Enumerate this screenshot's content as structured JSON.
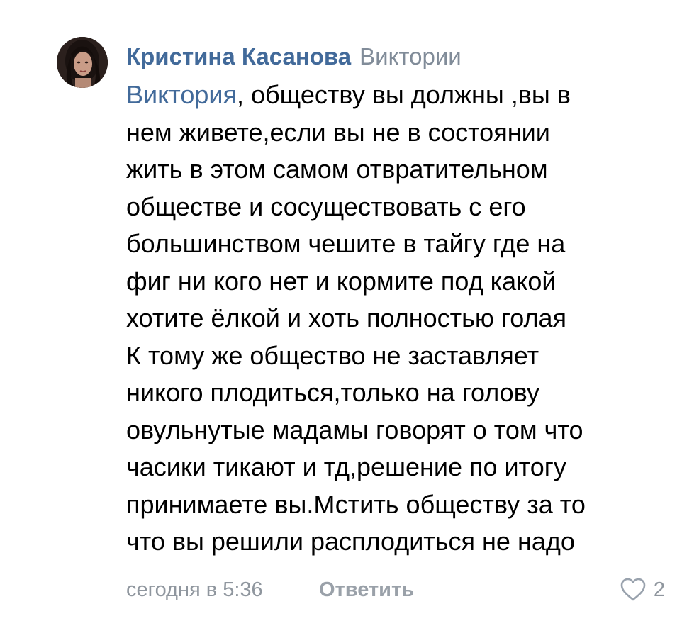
{
  "comment": {
    "author": "Кристина Касанова",
    "reply_to": "Виктории",
    "mention": "Виктория",
    "lines": [
      ", обществу вы должны ,вы в",
      "нем живете,если вы не в состоянии",
      "жить в этом самом отвратительном",
      "обществе и сосуществовать с его",
      "большинством чешите в тайгу где на",
      "фиг ни кого нет и кормите под какой",
      "хотите ёлкой и хоть полностью голая",
      "К тому же общество не заставляет",
      "никого плодиться,только на голову",
      "овульнутые мадамы говорят о том что",
      "часики тикают и тд,решение по итогу",
      "принимаете вы.Мстить обществу за то",
      "что вы решили расплодиться не надо"
    ],
    "timestamp": "сегодня в 5:36",
    "reply_label": "Ответить",
    "likes": "2"
  },
  "colors": {
    "link": "#426a9a",
    "secondary": "#818c99",
    "text": "#000000",
    "background": "#ffffff"
  },
  "icons": {
    "like": "heart-outline-icon",
    "avatar": "user-avatar-photo"
  }
}
